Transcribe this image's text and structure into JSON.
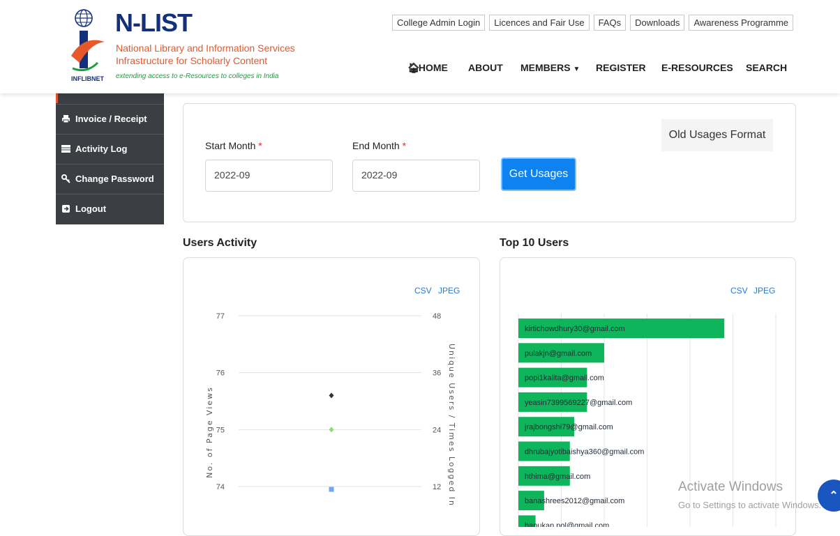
{
  "brand": {
    "title": "N-LIST",
    "subtitle_line1": "National Library and Information Services",
    "subtitle_line2": "Infrastructure for Scholarly Content",
    "tagline": "extending access to e-Resources to colleges in India",
    "emblem_label": "INFLIBNET"
  },
  "top_links": [
    "College Admin Login",
    "Licences and Fair Use",
    "FAQs",
    "Downloads",
    "Awareness Programme"
  ],
  "nav": {
    "home": "HOME",
    "about": "ABOUT",
    "members": "MEMBERS",
    "register": "REGISTER",
    "eresources": "E-RESOURCES",
    "search": "SEARCH"
  },
  "sidebar": {
    "items": [
      {
        "label": "Invoice / Receipt",
        "icon": "print-icon"
      },
      {
        "label": "Activity Log",
        "icon": "list-icon"
      },
      {
        "label": "Change Password",
        "icon": "key-icon"
      },
      {
        "label": "Logout",
        "icon": "logout-icon"
      }
    ]
  },
  "form": {
    "start_label": "Start Month",
    "end_label": "End Month",
    "required_mark": "*",
    "start_value": "2022-09",
    "end_value": "2022-09",
    "submit_label": "Get Usages",
    "old_format_label": "Old Usages Format"
  },
  "users_activity": {
    "title": "Users Activity",
    "csv": "CSV",
    "jpeg": "JPEG"
  },
  "top_users": {
    "title": "Top 10 Users",
    "csv": "CSV",
    "jpeg": "JPEG"
  },
  "colors": {
    "accent_blue": "#0d82f0",
    "sidebar_bg": "#3b3f44",
    "bar_green": "#0fb55a",
    "brand_orange": "#e8572c",
    "brand_navy": "#15307a"
  },
  "chart_data": [
    {
      "type": "scatter",
      "title": "",
      "ylabel": "No. of Page Views",
      "y2label": "Unique Users / Times Logged In",
      "ylim": [
        74,
        77
      ],
      "y2lim": [
        12,
        48
      ],
      "yticks": [
        "77",
        "76",
        "75",
        "74"
      ],
      "y2ticks": [
        "48",
        "36",
        "24",
        "12"
      ],
      "grid": true,
      "series": [
        {
          "axis": "left",
          "marker": "diamond",
          "color": "#333333",
          "values": [
            75.6
          ]
        },
        {
          "axis": "right",
          "marker": "diamond",
          "color": "#8ee06a",
          "values": [
            24
          ]
        },
        {
          "axis": "right",
          "marker": "square",
          "color": "#6aa9ef",
          "values": [
            11.4
          ]
        }
      ]
    },
    {
      "type": "bar",
      "orientation": "horizontal",
      "categories": [
        "kirtichowdhury30@gmail.com",
        "pulakjn@gmail.com",
        "popi1kalita@gmail.com",
        "yeasin7399569227@gmail.com",
        "jrajbongshi79@gmail.com",
        "dhrubajyotibaishya360@gmail.com",
        "hthima@gmail.com",
        "banashrees2012@gmail.com",
        "bapukan.pol@gmail.com"
      ],
      "values": [
        48,
        20,
        16,
        16,
        13,
        12,
        12,
        6,
        4
      ],
      "xlim": [
        0,
        60
      ],
      "grid": true,
      "color": "#0fb55a"
    }
  ]
}
